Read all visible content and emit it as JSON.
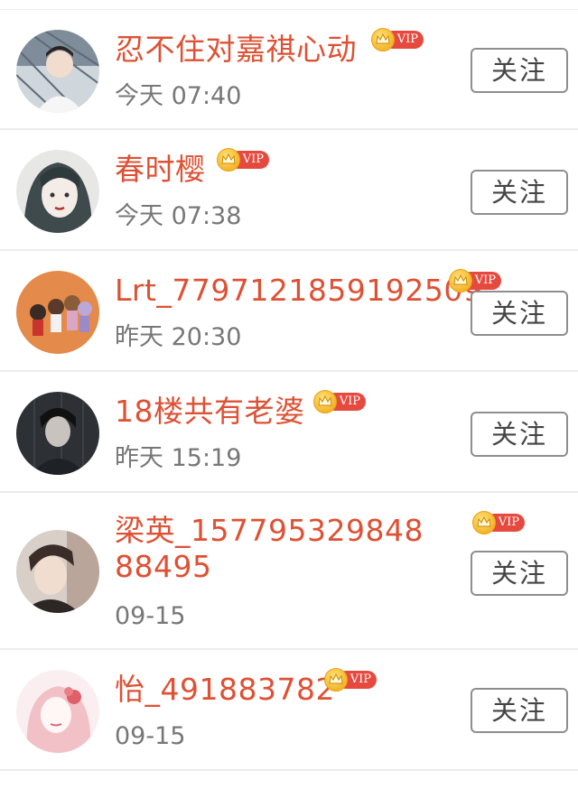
{
  "vip_badge_text": "VIP",
  "follow_label": "关注",
  "colors": {
    "name": "#de5134",
    "time": "#777777",
    "vip": "#e64a3f",
    "crown": "#f4b52c"
  },
  "users": [
    {
      "name": "忍不住对嘉祺心动",
      "time": "今天 07:40"
    },
    {
      "name": "春时樱",
      "time": "今天 07:38"
    },
    {
      "name": "Lrt_7797121859192509",
      "time": "昨天 20:30"
    },
    {
      "name": "18楼共有老婆",
      "time": "昨天 15:19"
    },
    {
      "name": "梁英_15779532984888495",
      "time": "09-15"
    },
    {
      "name": "怡_491883782",
      "time": "09-15"
    }
  ]
}
